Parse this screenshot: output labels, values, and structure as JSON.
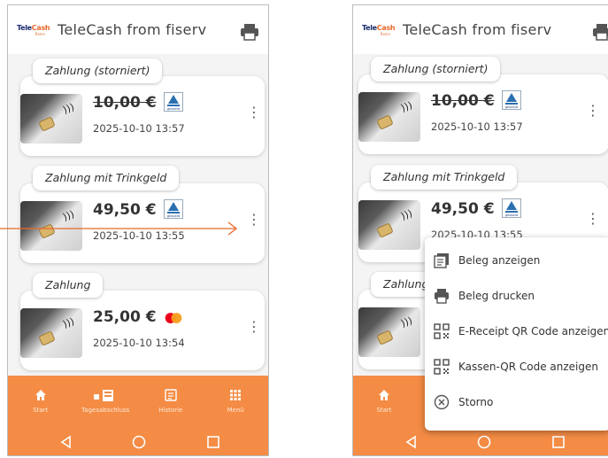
{
  "app": {
    "logo_text_tele": "Tele",
    "logo_text_cash": "Cash",
    "logo_sub": "fiserv",
    "title": "TeleCash from fiserv"
  },
  "transactions": [
    {
      "label": "Zahlung (storniert)",
      "amount": "10,00 €",
      "struck": true,
      "datetime": "2025-10-10 13:57",
      "badge": "girocard"
    },
    {
      "label": "Zahlung mit Trinkgeld",
      "amount": "49,50 €",
      "struck": false,
      "datetime": "2025-10-10 13:55",
      "badge": "girocard"
    },
    {
      "label": "Zahlung",
      "amount": "25,00 €",
      "struck": false,
      "datetime": "2025-10-10 13:54",
      "badge": "mastercard"
    }
  ],
  "right_transactions": [
    {
      "label": "Zahlung (storniert)",
      "amount": "10,00 €",
      "datetime": "2025-10-10 13:57"
    },
    {
      "label": "Zahlung mit Trinkgeld",
      "amount": "49,50 €",
      "datetime": "2025-10-10 13:55"
    },
    {
      "label": "Zahlung"
    }
  ],
  "badge_text": "girocard",
  "nav": {
    "start": "Start",
    "daily": "Tagesabschluss",
    "history": "Historie",
    "menu": "Menü"
  },
  "context_menu": [
    {
      "label": "Beleg anzeigen",
      "icon": "receipt-icon"
    },
    {
      "label": "Beleg drucken",
      "icon": "printer-icon"
    },
    {
      "label": "E-Receipt QR Code anzeigen",
      "icon": "qr-code-icon"
    },
    {
      "label": "Kassen-QR Code anzeigen",
      "icon": "qr-code-icon"
    },
    {
      "label": "Storno",
      "icon": "cancel-circle-icon"
    }
  ],
  "colors": {
    "accent": "#f48c45",
    "arrow": "#e8682a",
    "mastercard_red": "#eb001b",
    "mastercard_yellow": "#f79e1b"
  }
}
